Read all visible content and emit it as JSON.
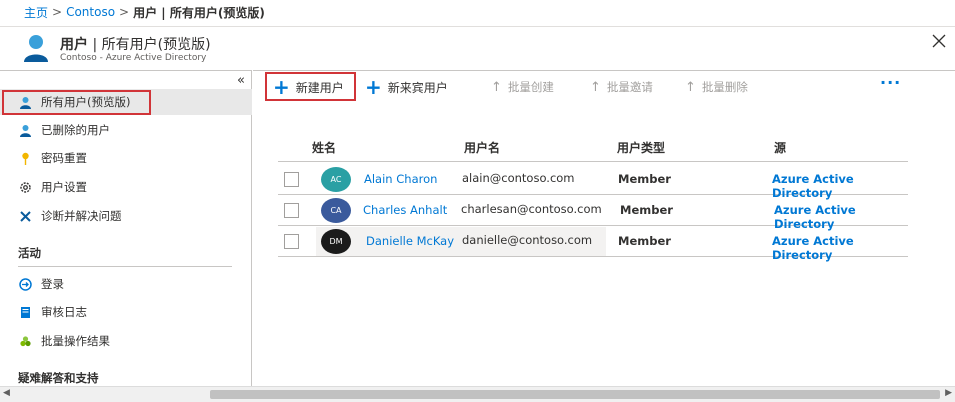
{
  "breadcrumb": {
    "home": "主页",
    "sep1": ">",
    "tenant": "Contoso",
    "sep2": ">",
    "current": "用户 | 所有用户(预览版)"
  },
  "header": {
    "title_bold": "用户",
    "title_rest": " | 所有用户(预览版)",
    "subtitle": "Contoso - Azure Active Directory"
  },
  "sidebar": {
    "collapse": "«",
    "items": [
      {
        "label": "所有用户(预览版)",
        "icon": "user-icon"
      },
      {
        "label": "已删除的用户",
        "icon": "deleted-user-icon"
      },
      {
        "label": "密码重置",
        "icon": "key-icon"
      },
      {
        "label": "用户设置",
        "icon": "gear-icon"
      },
      {
        "label": "诊断并解决问题",
        "icon": "wrench-icon"
      }
    ],
    "activity_label": "活动",
    "activity_items": [
      {
        "label": "登录",
        "icon": "sign-in-icon"
      },
      {
        "label": "审核日志",
        "icon": "audit-log-icon"
      },
      {
        "label": "批量操作结果",
        "icon": "bulk-results-icon"
      }
    ],
    "support_label": "疑难解答和支持"
  },
  "toolbar": {
    "new_user": "新建用户",
    "new_guest": "新来宾用户",
    "bulk_create": "批量创建",
    "bulk_invite": "批量邀请",
    "bulk_delete": "批量删除",
    "more": "···"
  },
  "table": {
    "columns": [
      "姓名",
      "用户名",
      "用户类型",
      "源"
    ],
    "rows": [
      {
        "initials": "AC",
        "name": "Alain Charon",
        "upn": "alain@contoso.com",
        "type": "Member",
        "source": "Azure Active Directory",
        "color": "#2aa0a4"
      },
      {
        "initials": "CA",
        "name": "Charles Anhalt",
        "upn": "charlesan@contoso.com",
        "type": "Member",
        "source": "Azure Active Directory",
        "color": "#3a5a9c"
      },
      {
        "initials": "DM",
        "name": "Danielle McKay",
        "upn": "danielle@contoso.com",
        "type": "Member",
        "source": "Azure Active Directory",
        "color": "#1b1b1b"
      }
    ]
  },
  "colors": {
    "accent": "#0078d4",
    "highlight": "#d13438"
  }
}
